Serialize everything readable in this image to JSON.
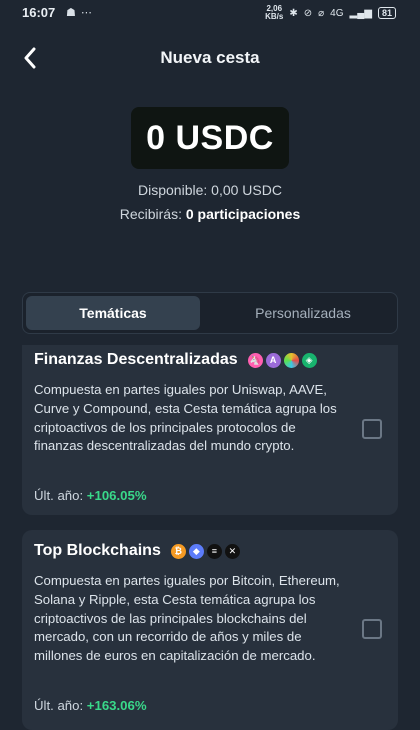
{
  "statusbar": {
    "time": "16:07",
    "left_icons": "☗ ⋯",
    "speed_top": "2,06",
    "speed_bottom": "KB/s",
    "network": "4G",
    "battery": "81"
  },
  "header": {
    "title": "Nueva cesta"
  },
  "amount": {
    "value": "0 USDC"
  },
  "available": {
    "label": "Disponible:",
    "value": "0,00 USDC"
  },
  "receive": {
    "label": "Recibirás:",
    "value": "0 participaciones"
  },
  "tabs": [
    {
      "label": "Temáticas",
      "active": true
    },
    {
      "label": "Personalizadas",
      "active": false
    }
  ],
  "baskets": [
    {
      "title": "Finanzas Descentralizadas",
      "coins": [
        {
          "icon": "uniswap-icon",
          "color": "#ff5fb0"
        },
        {
          "icon": "aave-icon",
          "color": "#9b6bd8"
        },
        {
          "icon": "curve-icon",
          "color": "#e4c02e"
        },
        {
          "icon": "compound-icon",
          "color": "#18b36e"
        }
      ],
      "description": "Compuesta en partes iguales por Uniswap, AAVE, Curve y Compound, esta Cesta temática agrupa los criptoactivos de los principales protocolos de finanzas descentralizadas del mundo crypto.",
      "return_label": "Últ. año:",
      "return_value": "+106.05%"
    },
    {
      "title": "Top Blockchains",
      "coins": [
        {
          "icon": "bitcoin-icon",
          "color": "#f59a23"
        },
        {
          "icon": "ethereum-icon",
          "color": "#5c7cfa"
        },
        {
          "icon": "solana-icon",
          "color": "#111111"
        },
        {
          "icon": "xrp-icon",
          "color": "#111111"
        }
      ],
      "description": "Compuesta en partes iguales por Bitcoin, Ethereum, Solana y Ripple, esta Cesta temática agrupa los criptoactivos de las principales blockchains del mercado, con un recorrido de años y miles de millones de euros en capitalización de mercado.",
      "return_label": "Últ. año:",
      "return_value": "+163.06%"
    }
  ],
  "colors": {
    "positive": "#39d98a",
    "background": "#1e2631",
    "card": "#28313d"
  }
}
